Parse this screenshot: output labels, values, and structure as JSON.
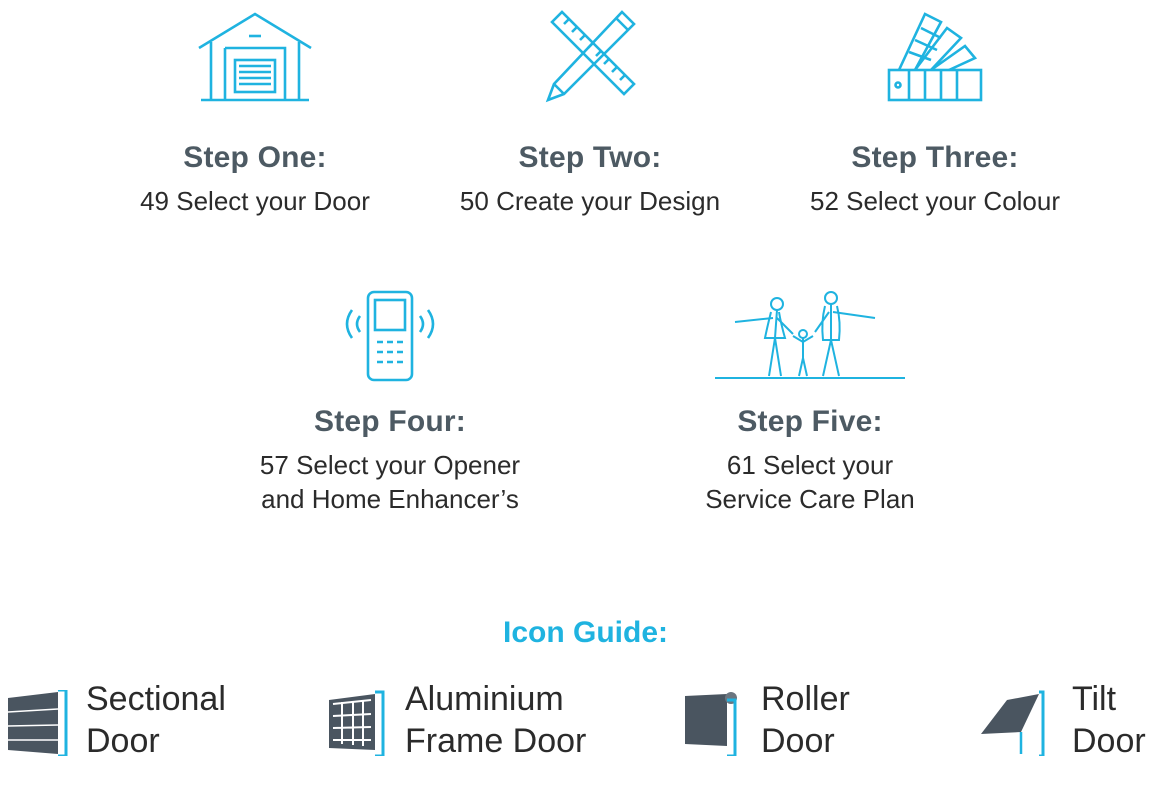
{
  "steps": [
    {
      "icon": "garage-icon",
      "title": "Step One:",
      "lines": [
        "49 Select your Door"
      ]
    },
    {
      "icon": "design-tools-icon",
      "title": "Step Two:",
      "lines": [
        "50 Create your Design"
      ]
    },
    {
      "icon": "colour-swatch-icon",
      "title": "Step Three:",
      "lines": [
        "52 Select your Colour"
      ]
    },
    {
      "icon": "remote-opener-icon",
      "title": "Step Four:",
      "lines": [
        "57 Select your Opener",
        "and Home Enhancer’s"
      ]
    },
    {
      "icon": "family-icon",
      "title": "Step Five:",
      "lines": [
        "61 Select your",
        "Service Care Plan"
      ]
    }
  ],
  "icon_guide": {
    "title": "Icon Guide:",
    "items": [
      {
        "icon": "sectional-door-icon",
        "lines": [
          "Sectional",
          "Door"
        ]
      },
      {
        "icon": "aluminium-frame-door-icon",
        "lines": [
          "Aluminium",
          "Frame Door"
        ]
      },
      {
        "icon": "roller-door-icon",
        "lines": [
          "Roller",
          "Door"
        ]
      },
      {
        "icon": "tilt-door-icon",
        "lines": [
          "Tilt",
          "Door"
        ]
      }
    ]
  },
  "colors": {
    "accent": "#1fb3e0",
    "heading": "#4d5a63",
    "text": "#2b2b2b",
    "icon_dark": "#4a5560"
  }
}
